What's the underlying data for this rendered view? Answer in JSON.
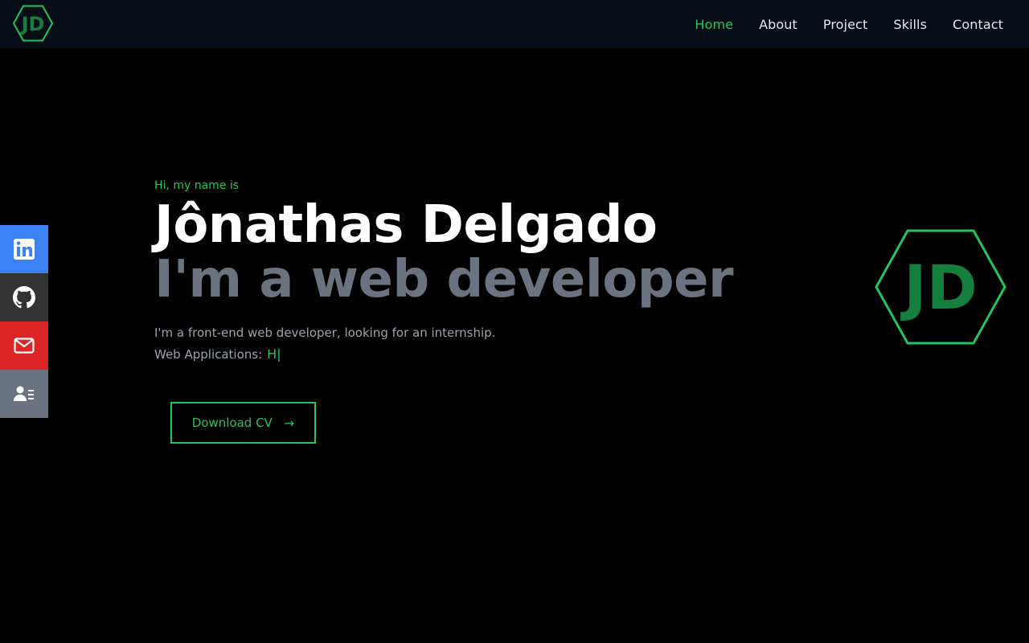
{
  "brand": {
    "logo_text": "JD",
    "accent": "#22c55e",
    "logo_fill": "#15803d"
  },
  "nav": {
    "items": [
      {
        "label": "Home",
        "active": true
      },
      {
        "label": "About",
        "active": false
      },
      {
        "label": "Project",
        "active": false
      },
      {
        "label": "Skills",
        "active": false
      },
      {
        "label": "Contact",
        "active": false
      }
    ]
  },
  "social": [
    {
      "icon": "linkedin-icon",
      "color": "#3b82f6"
    },
    {
      "icon": "github-icon",
      "color": "#333333"
    },
    {
      "icon": "mail-icon",
      "color": "#dc2626"
    },
    {
      "icon": "resume-icon",
      "color": "#6b7280"
    }
  ],
  "hero": {
    "greeting": "Hi, my name is",
    "name": "Jônathas Delgado",
    "role": "I'm a web developer",
    "description": "I'm a front-end web developer, looking for an internship.",
    "apps_label": "Web Applications:",
    "typed_text": "H",
    "cursor": "|",
    "cv_button": "Download CV",
    "cv_arrow": "→"
  }
}
